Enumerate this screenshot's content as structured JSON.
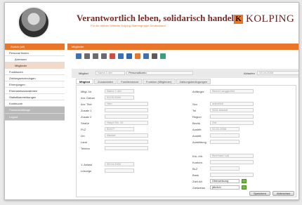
{
  "header": {
    "title": "Verantwortlich leben, solidarisch handeln",
    "subtitle": "Für die aktiven Mitlieder Kolping-Stammgruppe Deutschland",
    "brand_letter": "K",
    "brand_name": "KOLPING"
  },
  "sidebar": {
    "top": "Zurück (alt)",
    "items": [
      "Personal finden",
      "Adressen",
      "Mitglieder",
      "Funktionen",
      "Zahlungsrechnungen",
      "Ehrenjungen",
      "Ehrenamtsausnahmen",
      "Statistikanmeldungen",
      "Kontinuum"
    ],
    "gray_items": [
      "Passwortabfrage",
      "Logout"
    ]
  },
  "main": {
    "title": "Mitglieder",
    "record": {
      "label": "Mitglied",
      "value_id": "Name 1 der",
      "value_name": "Personalkonto",
      "status_label": "Ablaufen",
      "status_value": "03.04.2008"
    },
    "tabs": [
      "Mitglied",
      "Zusatzdaten",
      "Familienstand",
      "Funktion (Mitglieder)",
      "Zahlungsbedingungen"
    ],
    "left": {
      "labels": [
        "Mitgl.-Nr.",
        "Anr. Datum",
        "Anr. Titel",
        "Zusatz 1",
        "Zusatz 2",
        "Straße",
        "PLZ",
        "Ort",
        "Land",
        "Telefon"
      ],
      "values": [
        "Name 1 der",
        "03.05.2004",
        "Herr",
        "",
        "",
        "Haupt Str. 10",
        "52477",
        "Alsdorf",
        "",
        ""
      ]
    },
    "right": {
      "labels": [
        "Anfänger:",
        "",
        "Sex",
        "Tel",
        "Region",
        "Bezirk",
        "Austritt",
        "Austritt",
        "Ausbildung"
      ],
      "values": [
        "Bernd Langgruber",
        "",
        "männlich",
        "0241 Alsdorf",
        "",
        "Ost",
        "01.01.2008",
        "",
        ""
      ]
    },
    "bottom_left": {
      "labels": [
        "1. Anlass",
        "Lösungs"
      ],
      "values": [
        "05.04.2004",
        ""
      ]
    },
    "bottom_right": {
      "labels": [
        "Kto.-Inh.",
        "Kontonr.",
        "BLZ",
        "Bank",
        "Zahl.Art",
        "Zahlweise"
      ],
      "values": [
        "Bernhard Lub",
        "",
        "",
        "",
        "Überweisung",
        "jährlich"
      ]
    },
    "buttons": {
      "save": "Speichern",
      "delete": "Abbrechen"
    }
  },
  "colors": {
    "accent": "#e8762a",
    "brand": "#7b2a2a",
    "sidebar_gray": "#b9b9b9"
  }
}
